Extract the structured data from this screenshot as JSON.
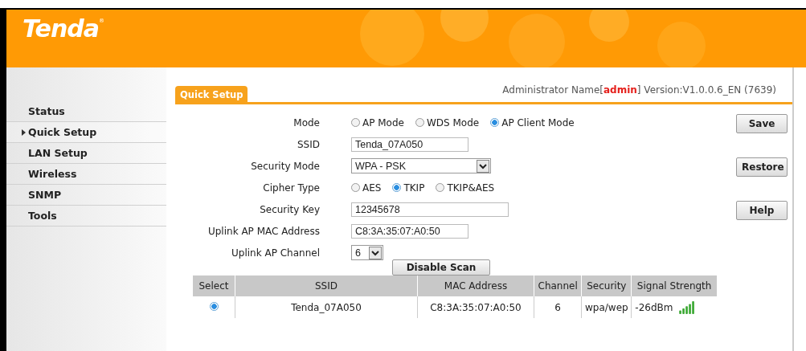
{
  "header": {
    "logo": "Tenda",
    "logo_mark": "®"
  },
  "sidebar": {
    "items": [
      {
        "label": "Status",
        "selected": false
      },
      {
        "label": "Quick Setup",
        "selected": true
      },
      {
        "label": "LAN Setup",
        "selected": false
      },
      {
        "label": "Wireless",
        "selected": false
      },
      {
        "label": "SNMP",
        "selected": false
      },
      {
        "label": "Tools",
        "selected": false
      }
    ]
  },
  "tabs": [
    {
      "label": "Quick Setup",
      "selected": true
    }
  ],
  "admin_info": "Administrator Name[**admin**] Version:V1.0.0.6_EN (7639)",
  "form": {
    "rows": [
      {
        "kind": "radio",
        "label": "Mode",
        "options": [
          {
            "label": "AP Mode",
            "selected": false
          },
          {
            "label": "WDS Mode",
            "selected": false
          },
          {
            "label": "AP Client Mode",
            "selected": true
          }
        ]
      },
      {
        "kind": "text",
        "label": "SSID",
        "value": "Tenda_07A050"
      },
      {
        "kind": "select",
        "label": "Security Mode",
        "value": "WPA - PSK"
      },
      {
        "kind": "radio",
        "label": "Cipher Type",
        "options": [
          {
            "label": "AES",
            "selected": false
          },
          {
            "label": "TKIP",
            "selected": true
          },
          {
            "label": "TKIP&AES",
            "selected": false
          }
        ]
      },
      {
        "kind": "text",
        "label": "Security Key",
        "value": "12345678"
      },
      {
        "kind": "text",
        "label": "Uplink AP MAC Address",
        "value": "C8:3A:35:07:A0:50"
      },
      {
        "kind": "select",
        "label": "Uplink AP Channel",
        "value": "6"
      }
    ]
  },
  "side_buttons": [
    "Save",
    "Restore",
    "Help"
  ],
  "scan_button": "Disable Scan",
  "table": {
    "columns": [
      "Select",
      "SSID",
      "MAC Address",
      "Channel",
      "Security",
      "Signal Strength"
    ],
    "rows": [
      {
        "selected": true,
        "ssid": "Tenda_07A050",
        "mac": "C8:3A:35:07:A0:50",
        "channel": "6",
        "security": "wpa/wep",
        "signal": "-26dBm"
      }
    ]
  }
}
